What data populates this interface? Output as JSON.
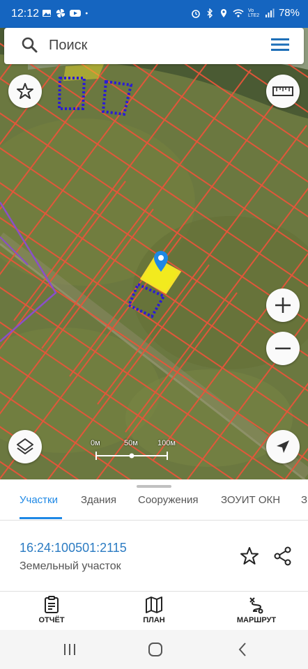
{
  "status_bar": {
    "time": "12:12",
    "battery": "78%",
    "left_icons": [
      "gallery-icon",
      "pinwheel-icon",
      "youtube-icon",
      "dot-icon"
    ],
    "right_icons": [
      "alarm-icon",
      "bluetooth-icon",
      "location-icon",
      "wifi-icon",
      "volte-icon",
      "signal-icon"
    ],
    "volte_text": "Vo LTE2"
  },
  "search": {
    "placeholder": "Поиск"
  },
  "map": {
    "scale_labels": [
      "0м",
      "50м",
      "100м"
    ],
    "parcel_highlight_color": "#f5e12a",
    "grid_line_color": "#e8553a",
    "dotted_outline_color": "#2a1ad6"
  },
  "tabs": [
    {
      "label": "Участки",
      "active": true
    },
    {
      "label": "Здания",
      "active": false
    },
    {
      "label": "Сооружения",
      "active": false
    },
    {
      "label": "ЗОУИТ ОКН",
      "active": false
    },
    {
      "label": "З",
      "active": false
    }
  ],
  "parcel": {
    "cadastral_number": "16:24:100501:2115",
    "type": "Земельный участок"
  },
  "bottom_nav": [
    {
      "label": "ОТЧЁТ",
      "icon": "report-icon"
    },
    {
      "label": "ПЛАН",
      "icon": "map-plan-icon"
    },
    {
      "label": "МАРШРУТ",
      "icon": "route-icon"
    }
  ],
  "colors": {
    "accent": "#1e88e5",
    "status_bar": "#1565c0"
  }
}
